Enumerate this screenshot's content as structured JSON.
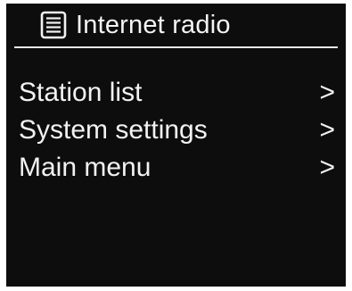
{
  "header": {
    "title": "Internet radio",
    "icon": "list-icon"
  },
  "menu": {
    "items": [
      {
        "label": "Station list",
        "chevron": ">"
      },
      {
        "label": "System settings",
        "chevron": ">"
      },
      {
        "label": "Main menu",
        "chevron": ">"
      }
    ]
  },
  "colors": {
    "background": "#0d0d0d",
    "foreground": "#f2f2f2"
  }
}
